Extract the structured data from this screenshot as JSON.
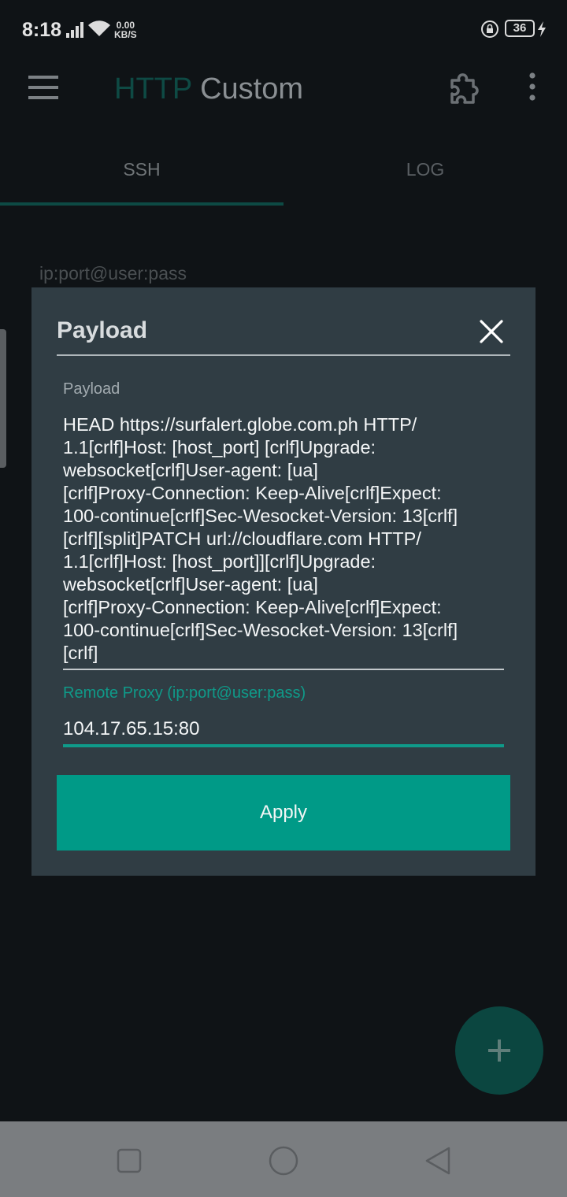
{
  "status_bar": {
    "time": "8:18",
    "net_speed_value": "0.00",
    "net_speed_unit": "KB/S",
    "battery_level": "36"
  },
  "app_bar": {
    "title_part1": "HTTP",
    "title_part2": " Custom",
    "icons": [
      "menu-icon",
      "puzzle-icon",
      "more-vert-icon"
    ]
  },
  "tabs": [
    {
      "label": "SSH",
      "selected": true
    },
    {
      "label": "LOG",
      "selected": false
    }
  ],
  "background": {
    "ssh_input_placeholder": "ip:port@user:pass"
  },
  "dialog": {
    "title": "Payload",
    "payload_label": "Payload",
    "payload_value": "HEAD https://surfalert.globe.com.ph HTTP/\n1.1[crlf]Host: [host_port] [crlf]Upgrade:\nwebsocket[crlf]User-agent: [ua]\n[crlf]Proxy-Connection: Keep-Alive[crlf]Expect:\n100-continue[crlf]Sec-Wesocket-Version: 13[crlf]\n[crlf][split]PATCH url://cloudflare.com HTTP/\n1.1[crlf]Host: [host_port]][crlf]Upgrade:\nwebsocket[crlf]User-agent: [ua]\n[crlf]Proxy-Connection: Keep-Alive[crlf]Expect:\n100-continue[crlf]Sec-Wesocket-Version: 13[crlf]\n[crlf]",
    "proxy_label": "Remote Proxy (ip:port@user:pass)",
    "proxy_value": "104.17.65.15:80",
    "apply_label": "Apply"
  },
  "colors": {
    "accent": "#009a87",
    "dialog_bg": "#303d44",
    "screen_bg": "#0f1316"
  }
}
